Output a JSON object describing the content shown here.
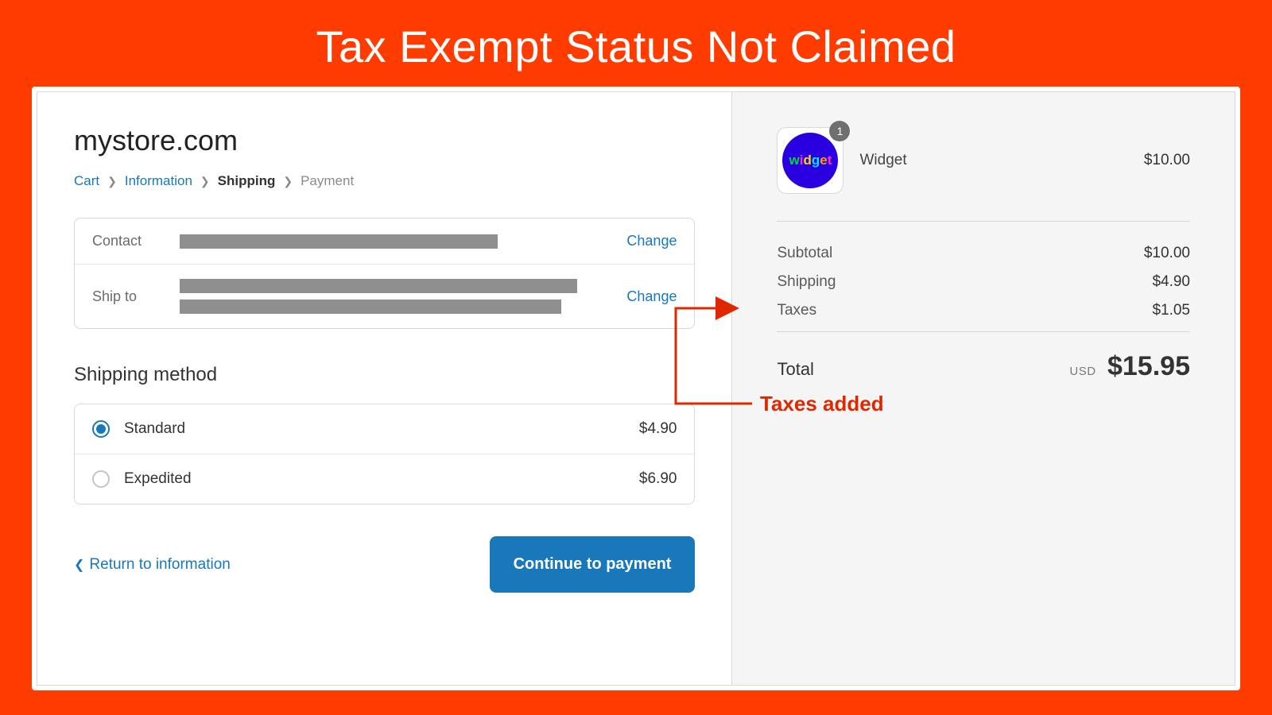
{
  "slide": {
    "title": "Tax Exempt Status Not Claimed"
  },
  "store": {
    "name": "mystore.com"
  },
  "breadcrumbs": {
    "cart": "Cart",
    "information": "Information",
    "shipping": "Shipping",
    "payment": "Payment"
  },
  "info": {
    "contact_label": "Contact",
    "shipto_label": "Ship to",
    "change": "Change"
  },
  "shipping": {
    "heading": "Shipping method",
    "options": [
      {
        "name": "Standard",
        "price": "$4.90",
        "selected": true
      },
      {
        "name": "Expedited",
        "price": "$6.90",
        "selected": false
      }
    ]
  },
  "nav": {
    "back": "Return to information",
    "continue": "Continue to payment"
  },
  "cart": {
    "item_name": "Widget",
    "item_price": "$10.00",
    "qty": "1"
  },
  "summary": {
    "subtotal_label": "Subtotal",
    "subtotal": "$10.00",
    "shipping_label": "Shipping",
    "shipping": "$4.90",
    "taxes_label": "Taxes",
    "taxes": "$1.05",
    "total_label": "Total",
    "currency": "USD",
    "total": "$15.95"
  },
  "annotation": {
    "label": "Taxes added"
  },
  "colors": {
    "accent": "#ff3c00",
    "link": "#1878b9",
    "primary_btn": "#1878b9"
  }
}
